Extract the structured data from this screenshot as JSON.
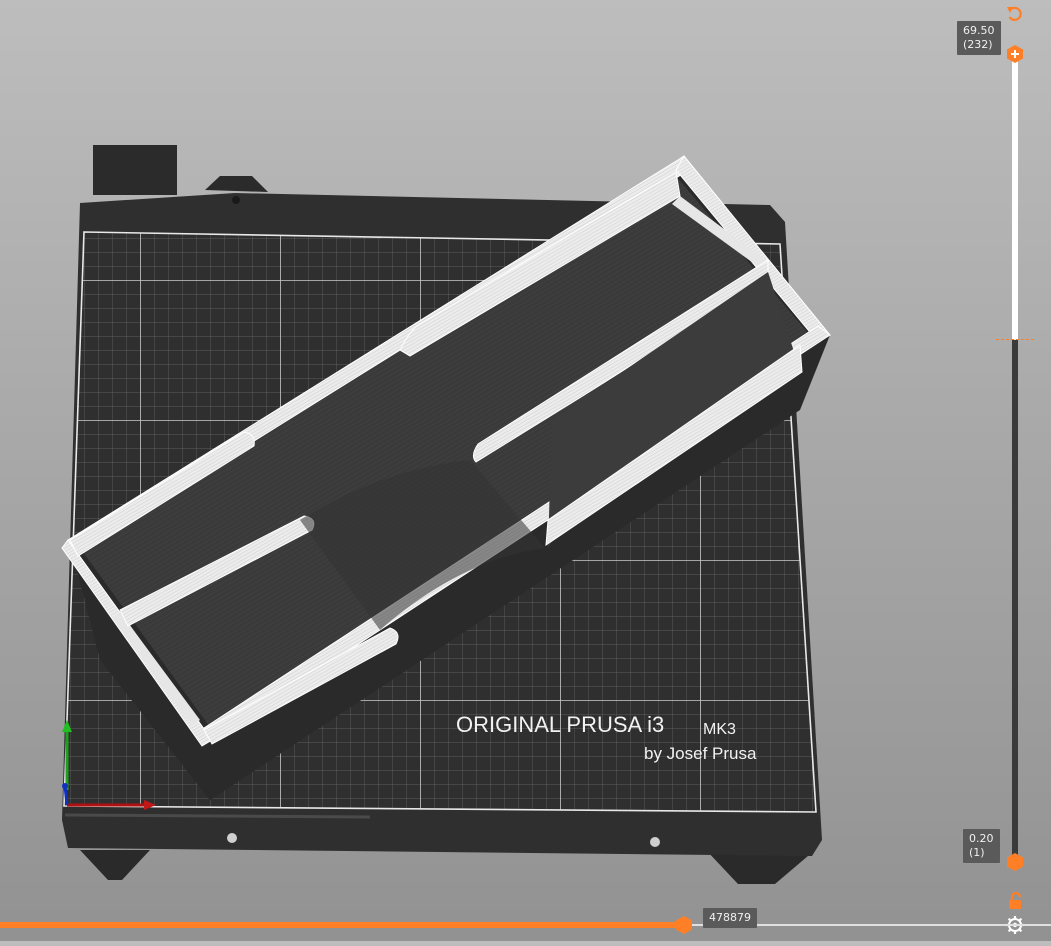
{
  "scene": {
    "bed_brand": "ORIGINAL PRUSA i3",
    "bed_model": "MK3",
    "bed_credit": "by Josef Prusa"
  },
  "vertical_slider": {
    "top_height": "69.50",
    "top_layer": "(232)",
    "bottom_height": "0.20",
    "bottom_layer": "(1)"
  },
  "horizontal_slider": {
    "move_value": "478879",
    "fraction": 0.65
  },
  "icons": {
    "undo": "revert-icon",
    "lock": "unlock-icon",
    "settings": "cog-icon"
  },
  "colors": {
    "accent": "#ff7f27",
    "bed": "#2f2f2f",
    "print_body": "#3a3a3a",
    "print_wall": "#e8e8e8"
  }
}
